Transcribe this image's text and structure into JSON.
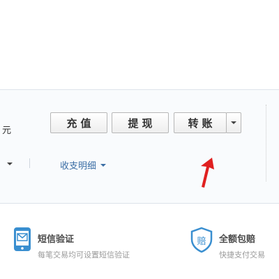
{
  "balance": {
    "unit": "元"
  },
  "actions": {
    "recharge_label": "充值",
    "withdraw_label": "提现",
    "transfer_label": "转账"
  },
  "links": {
    "details_label": "收支明细"
  },
  "security": {
    "sms": {
      "title": "短信验证",
      "desc": "每笔交易均可设置短信验证",
      "icon": "phone-message-icon"
    },
    "compensation": {
      "title": "全额包赔",
      "desc": "快捷支付交易",
      "icon": "shield-compensation-icon"
    }
  },
  "colors": {
    "link": "#3b6ea5",
    "icon_blue": "#3a8fd0",
    "arrow_red": "#e02020"
  }
}
